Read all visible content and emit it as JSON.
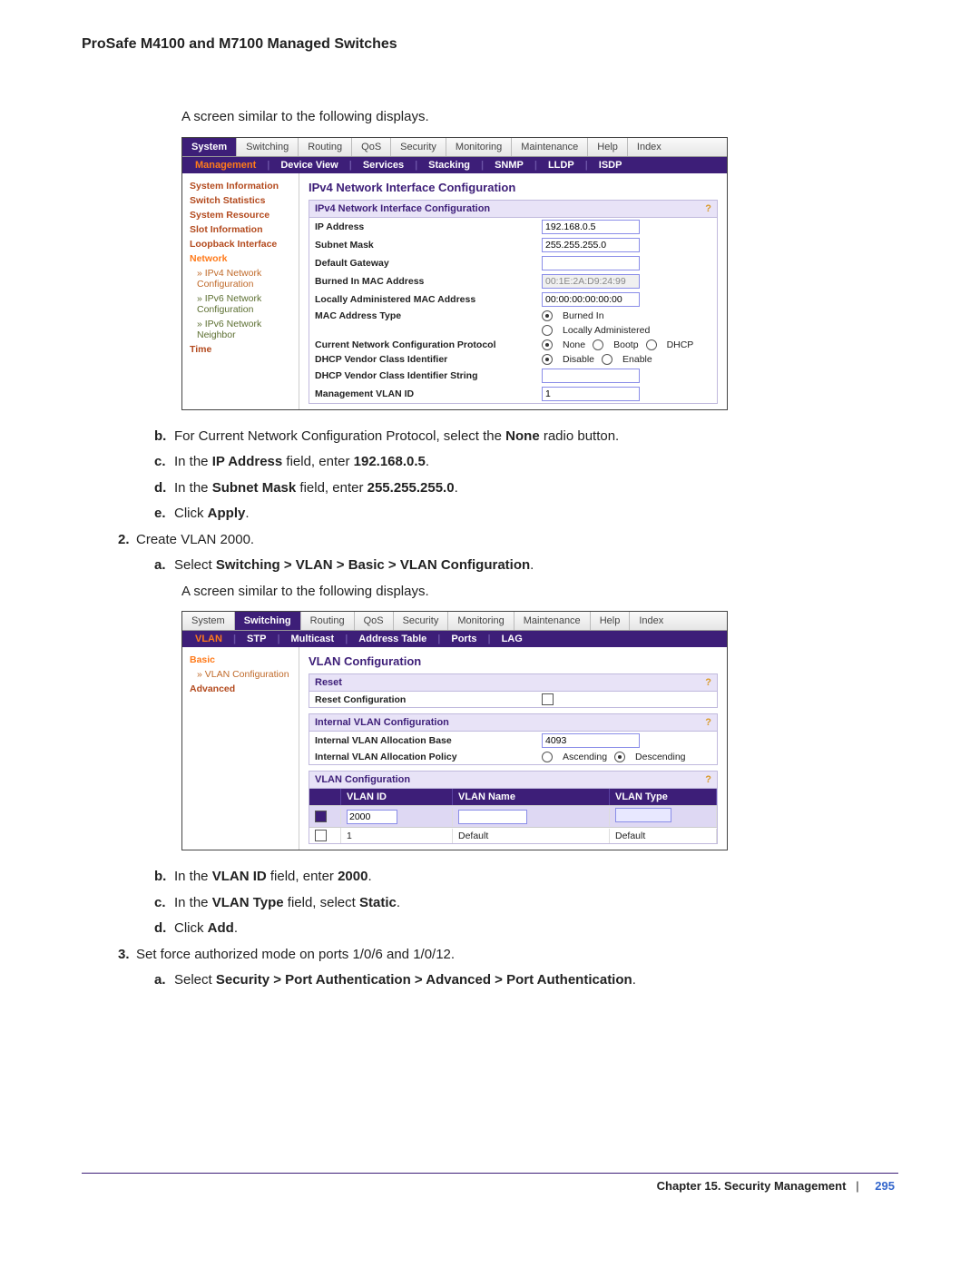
{
  "doc_header": "ProSafe M4100 and M7100 Managed Switches",
  "intro": "A screen similar to the following displays.",
  "shot1": {
    "tabs": [
      "System",
      "Switching",
      "Routing",
      "QoS",
      "Security",
      "Monitoring",
      "Maintenance",
      "Help",
      "Index"
    ],
    "active_tab": 0,
    "subtabs": [
      "Management",
      "Device View",
      "Services",
      "Stacking",
      "SNMP",
      "LLDP",
      "ISDP"
    ],
    "sub_active": 0,
    "side": [
      "System Information",
      "Switch Statistics",
      "System Resource",
      "Slot Information",
      "Loopback Interface",
      "Network",
      "» IPv4 Network Configuration",
      "» IPv6 Network Configuration",
      "» IPv6 Network Neighbor",
      "Time"
    ],
    "main_title": "IPv4 Network Interface Configuration",
    "panel_head": "IPv4 Network Interface Configuration",
    "rows": {
      "ip_label": "IP Address",
      "ip_val": "192.168.0.5",
      "mask_label": "Subnet Mask",
      "mask_val": "255.255.255.0",
      "gw_label": "Default Gateway",
      "gw_val": "",
      "burn_label": "Burned In MAC Address",
      "burn_val": "00:1E:2A:D9:24:99",
      "local_label": "Locally Administered MAC Address",
      "local_val": "00:00:00:00:00:00",
      "mt_label": "MAC Address Type",
      "mt_opt1": "Burned In",
      "mt_opt2": "Locally Administered",
      "proto_label": "Current Network Configuration Protocol",
      "proto_opts": [
        "None",
        "Bootp",
        "DHCP"
      ],
      "dvc_label": "DHCP Vendor Class Identifier",
      "dvc_opts": [
        "Disable",
        "Enable"
      ],
      "dvcs_label": "DHCP Vendor Class Identifier String",
      "dvcs_val": "",
      "vlan_label": "Management VLAN ID",
      "vlan_val": "1"
    }
  },
  "steps": {
    "b1": "For Current Network Configuration Protocol, select the ",
    "b1_bold": "None",
    "b1_tail": " radio button.",
    "c1_pre": "In the ",
    "c1_b1": "IP Address",
    "c1_mid": " field, enter ",
    "c1_b2": "192.168.0.5",
    "c1_end": ".",
    "d1_pre": "In the ",
    "d1_b1": "Subnet Mask",
    "d1_mid": " field, enter ",
    "d1_b2": "255.255.255.0",
    "d1_end": ".",
    "e1_pre": "Click ",
    "e1_b": "Apply",
    "e1_end": ".",
    "n2": "Create VLAN 2000.",
    "a2_pre": "Select ",
    "a2_b": "Switching > VLAN > Basic > VLAN Configuration",
    "a2_end": ".",
    "intro2": "A screen similar to the following displays."
  },
  "shot2": {
    "tabs": [
      "System",
      "Switching",
      "Routing",
      "QoS",
      "Security",
      "Monitoring",
      "Maintenance",
      "Help",
      "Index"
    ],
    "active_tab": 1,
    "subtabs": [
      "VLAN",
      "STP",
      "Multicast",
      "Address Table",
      "Ports",
      "LAG"
    ],
    "sub_active": 0,
    "side": [
      "Basic",
      "» VLAN Configuration",
      "Advanced"
    ],
    "main_title": "VLAN Configuration",
    "reset_head": "Reset",
    "reset_row": "Reset Configuration",
    "ivc_head": "Internal VLAN Configuration",
    "ivc_base_label": "Internal VLAN Allocation Base",
    "ivc_base_val": "4093",
    "ivc_pol_label": "Internal VLAN Allocation Policy",
    "ivc_pol_asc": "Ascending",
    "ivc_pol_desc": "Descending",
    "vc_head": "VLAN Configuration",
    "cols": [
      "VLAN ID",
      "VLAN Name",
      "VLAN Type"
    ],
    "new_row_id": "2000",
    "row1_id": "1",
    "row1_name": "Default",
    "row1_type": "Default"
  },
  "steps2": {
    "b_pre": "In the ",
    "b_b1": "VLAN ID",
    "b_mid": " field, enter ",
    "b_b2": "2000",
    "b_end": ".",
    "c_pre": "In the ",
    "c_b1": "VLAN Type",
    "c_mid": " field, select ",
    "c_b2": "Static",
    "c_end": ".",
    "d_pre": "Click ",
    "d_b": "Add",
    "d_end": ".",
    "n3": "Set force authorized mode on ports 1/0/6 and 1/0/12.",
    "a3_pre": "Select ",
    "a3_b": "Security > Port Authentication > Advanced > Port Authentication",
    "a3_end": "."
  },
  "footer": {
    "chapter": "Chapter 15.  Security Management",
    "sep": "|",
    "page": "295"
  }
}
